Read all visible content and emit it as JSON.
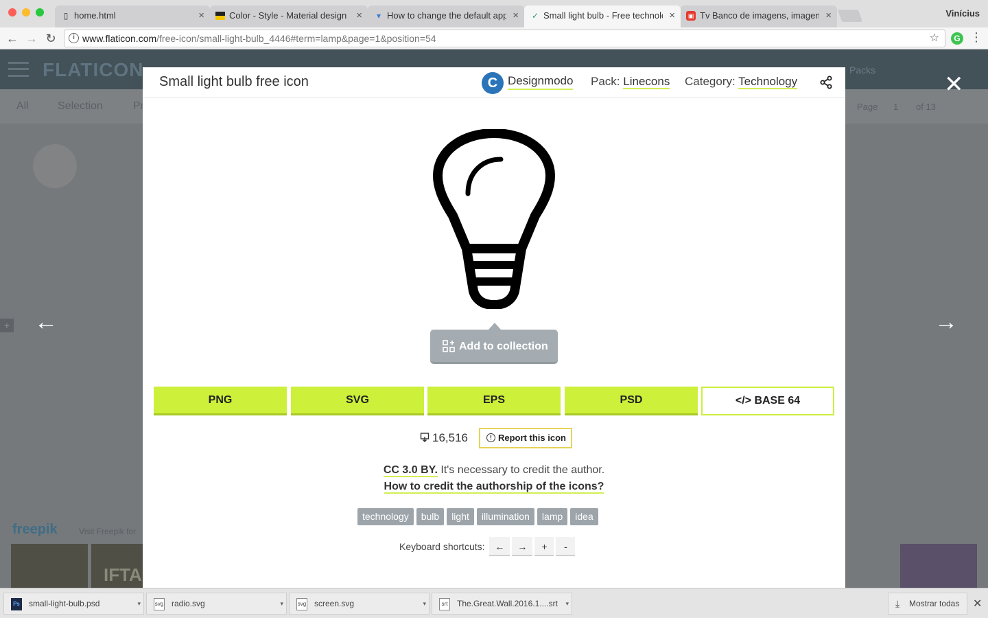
{
  "browser": {
    "tabs": [
      {
        "title": "home.html",
        "favicon": "document-icon",
        "x": 0
      },
      {
        "title": "Color - Style - Material design",
        "favicon": "material-icon"
      },
      {
        "title": "How to change the default app",
        "favicon": "drop-icon"
      },
      {
        "title": "Small light bulb - Free technolo",
        "favicon": "flaticon-icon"
      },
      {
        "title": "Tv Banco de imagens, imagens",
        "favicon": "image-icon"
      }
    ],
    "user": "Vinícius",
    "url_host": "www.flaticon.com",
    "url_path": "/free-icon/small-light-bulb_4446#term=lamp&page=1&position=54",
    "extension_letter": "G"
  },
  "background_page": {
    "logo": "FLATICON",
    "packs": "Packs",
    "filters": [
      "All",
      "Selection",
      "Pr"
    ],
    "page_label": "Page",
    "page_value": "1",
    "page_total": "of 13",
    "freepik_logo": "freepik",
    "freepik_text": "Visit Freepik for",
    "thumb_text": "IFTA"
  },
  "modal": {
    "title": "Small light bulb free icon",
    "author": "Designmodo",
    "author_logo": "C",
    "pack_label": "Pack:",
    "pack_value": "Linecons",
    "category_label": "Category:",
    "category_value": "Technology",
    "add_collection": "Add to collection",
    "formats": [
      "PNG",
      "SVG",
      "EPS",
      "PSD",
      "</> BASE 64"
    ],
    "downloads": "16,516",
    "report": "Report this icon",
    "license_link": "CC 3.0 BY.",
    "license_text": " It's necessary to credit the author.",
    "credit_link": "How to credit the authorship of the icons?",
    "tags": [
      "technology",
      "bulb",
      "light",
      "illumination",
      "lamp",
      "idea"
    ],
    "shortcuts_label": "Keyboard shortcuts:",
    "shortcut_keys": [
      "←",
      "→",
      "+",
      "-"
    ],
    "close": "✕",
    "prev": "←",
    "next": "→"
  },
  "shelf": {
    "items": [
      {
        "name": "small-light-bulb.psd",
        "icon": "Ps"
      },
      {
        "name": "radio.svg",
        "icon": "svg"
      },
      {
        "name": "screen.svg",
        "icon": "svg"
      },
      {
        "name": "The.Great.Wall.2016.1....srt",
        "icon": "srt"
      }
    ],
    "show_all": "Mostrar todas",
    "close": "✕"
  },
  "colors": {
    "accent": "#cdf03a",
    "overlay": "#75797c",
    "collection_button": "#a4acb1",
    "tag": "#9da5ab"
  }
}
